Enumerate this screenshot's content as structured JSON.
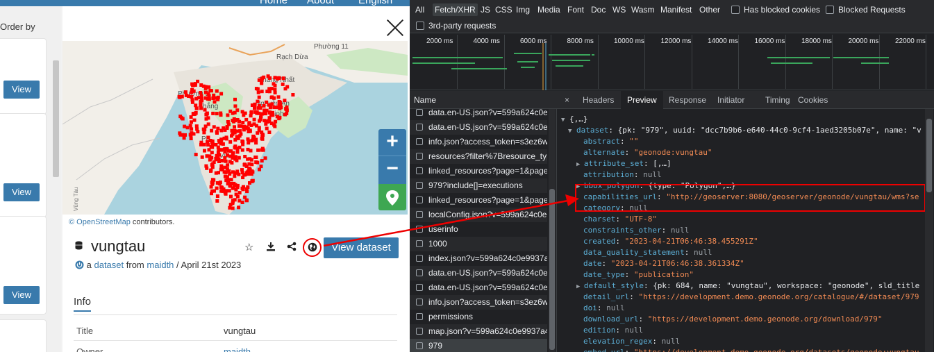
{
  "site": {
    "nav": [
      "Home",
      "About",
      "English"
    ],
    "order_by": "Order by",
    "view_label": "View"
  },
  "modal": {
    "map_labels": [
      "Phường 11",
      "Rạch Dừa",
      "Thắng Nhất",
      "Phường 5",
      "Thắng",
      "Nguyễn An",
      "Ninh",
      "Ph",
      "Vũ",
      "Vũng Tàu"
    ],
    "attribution_link": "© OpenStreetMap",
    "attribution_rest": " contributors.",
    "dataset_title": "vungtau",
    "subtitle_prefix": "a",
    "subtitle_type": "dataset",
    "subtitle_from": "from",
    "subtitle_owner": "maidth",
    "subtitle_date": "/ April 21st 2023",
    "view_dataset": "View dataset",
    "info_tab": "Info",
    "rows": [
      {
        "key": "Title",
        "value": "vungtau"
      },
      {
        "key": "Owner",
        "value": "maidth"
      }
    ],
    "icons": [
      "database-icon",
      "star-icon",
      "download-icon",
      "share-icon",
      "globe-icon"
    ],
    "zoom_in": "+",
    "zoom_out": "−"
  },
  "devtools": {
    "filter_types": [
      "All",
      "Fetch/XHR",
      "JS",
      "CSS",
      "Img",
      "Media",
      "Font",
      "Doc",
      "WS",
      "Wasm",
      "Manifest",
      "Other"
    ],
    "active_filter": "Fetch/XHR",
    "has_blocked_cookies": "Has blocked cookies",
    "blocked_requests": "Blocked Requests",
    "third_party": "3rd-party requests",
    "timeline_ticks": [
      "2000 ms",
      "4000 ms",
      "6000 ms",
      "8000 ms",
      "10000 ms",
      "12000 ms",
      "14000 ms",
      "16000 ms",
      "18000 ms",
      "20000 ms",
      "22000 ms",
      "2"
    ],
    "name_header": "Name",
    "requests": [
      "data.en-US.json?v=599a624c0e9",
      "data.en-US.json?v=599a624c0e9",
      "info.json?access_token=s3ez6wi",
      "resources?filter%7Bresource_typ",
      "linked_resources?page=1&page",
      "979?include[]=executions",
      "linked_resources?page=1&page",
      "localConfig.json?v=599a624c0e9",
      "userinfo",
      "1000",
      "index.json?v=599a624c0e9937a4",
      "data.en-US.json?v=599a624c0e9",
      "data.en-US.json?v=599a624c0e9",
      "info.json?access_token=s3ez6wi",
      "permissions",
      "map.json?v=599a624c0e9937a4",
      "979"
    ],
    "close_label": "×",
    "tabs": [
      "Headers",
      "Preview",
      "Response",
      "Initiator",
      "Timing",
      "Cookies"
    ],
    "active_tab": "Preview",
    "preview": {
      "root": "{,…}",
      "dataset_key": "dataset",
      "dataset_val": "{pk: \"979\", uuid: \"dcc7b9b6-e640-44c0-9cf4-1aed3205b07e\", name: \"v",
      "lines": [
        {
          "k": "abstract",
          "v": "\"\"",
          "t": "str"
        },
        {
          "k": "alternate",
          "v": "\"geonode:vungtau\"",
          "t": "str"
        },
        {
          "k": "attribute_set",
          "v": "[,…]",
          "t": "plain",
          "exp": true
        },
        {
          "k": "attribution",
          "v": "null",
          "t": "nul"
        },
        {
          "k": "bbox_polygon",
          "v": "{type: \"Polygon\",…}",
          "t": "plain",
          "exp": true
        },
        {
          "k": "capabilities_url",
          "v": "\"http://geoserver:8080/geoserver/geonode/vungtau/wms?se",
          "t": "str"
        },
        {
          "k": "category",
          "v": "null",
          "t": "nul"
        },
        {
          "k": "charset",
          "v": "\"UTF-8\"",
          "t": "str"
        },
        {
          "k": "constraints_other",
          "v": "null",
          "t": "nul"
        },
        {
          "k": "created",
          "v": "\"2023-04-21T06:46:38.455291Z\"",
          "t": "str"
        },
        {
          "k": "data_quality_statement",
          "v": "null",
          "t": "nul"
        },
        {
          "k": "date",
          "v": "\"2023-04-21T06:46:38.361334Z\"",
          "t": "str"
        },
        {
          "k": "date_type",
          "v": "\"publication\"",
          "t": "str"
        },
        {
          "k": "default_style",
          "v": "{pk: 684, name: \"vungtau\", workspace: \"geonode\", sld_title",
          "t": "plain",
          "exp": true
        },
        {
          "k": "detail_url",
          "v": "\"https://development.demo.geonode.org/catalogue/#/dataset/979",
          "t": "str"
        },
        {
          "k": "doi",
          "v": "null",
          "t": "nul"
        },
        {
          "k": "download_url",
          "v": "\"https://development.demo.geonode.org/download/979\"",
          "t": "str"
        },
        {
          "k": "edition",
          "v": "null",
          "t": "nul"
        },
        {
          "k": "elevation_regex",
          "v": "null",
          "t": "nul"
        },
        {
          "k": "embed_url",
          "v": "\"https://development.demo.geonode.org/datasets/geonode:vungtau",
          "t": "str"
        }
      ]
    }
  },
  "colors": {
    "brand_blue": "#397aac",
    "annotation_red": "#e00000",
    "json_key": "#5db0d7",
    "json_string": "#f28b54"
  }
}
